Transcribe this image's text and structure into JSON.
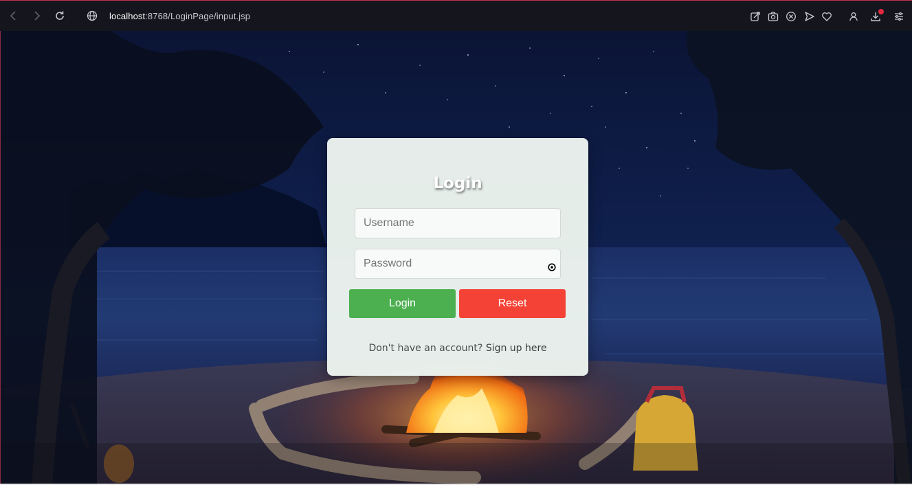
{
  "browser": {
    "url_host": "localhost",
    "url_rest": ":8768/LoginPage/input.jsp",
    "icons": [
      "back-icon",
      "forward-icon",
      "reload-icon",
      "globe-icon",
      "share-icon",
      "camera-icon",
      "close-circle-icon",
      "send-icon",
      "heart-icon",
      "profile-icon",
      "download-icon",
      "menu-icon"
    ],
    "notification_color": "#e5293e"
  },
  "login": {
    "title": "Login",
    "username_placeholder": "Username",
    "password_placeholder": "Password",
    "login_label": "Login",
    "reset_label": "Reset",
    "signup_prompt": "Don't have an account?",
    "signup_link": "Sign up here",
    "colors": {
      "login_button": "#4caf50",
      "reset_button": "#f44336",
      "card": "#ecf4ee"
    }
  },
  "background": {
    "scene": "campfire-beach-night"
  }
}
